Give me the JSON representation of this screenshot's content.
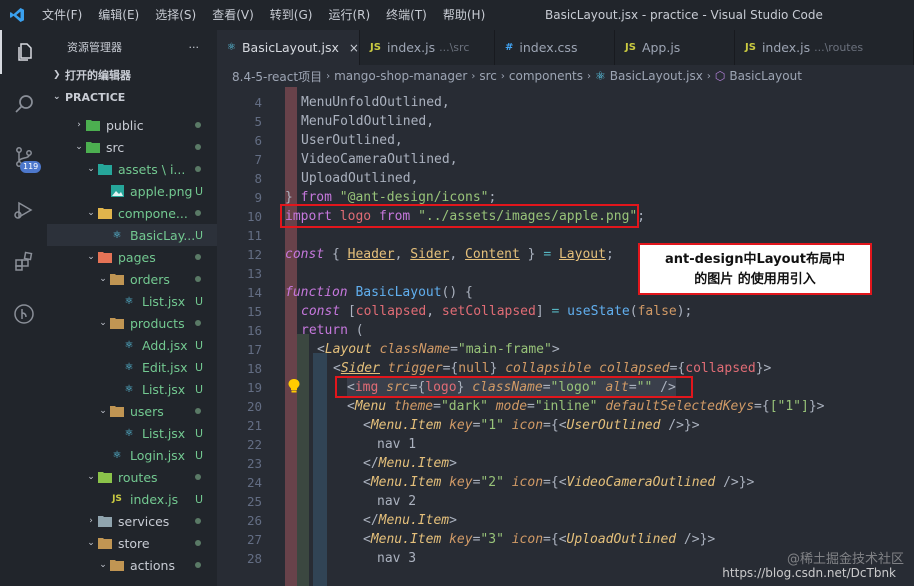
{
  "titlebar": {
    "menu": [
      "文件(F)",
      "编辑(E)",
      "选择(S)",
      "查看(V)",
      "转到(G)",
      "运行(R)",
      "终端(T)",
      "帮助(H)"
    ],
    "window_title": "BasicLayout.jsx - practice - Visual Studio Code"
  },
  "activity": {
    "scm_badge": "119"
  },
  "sidebar": {
    "title": "资源管理器",
    "more": "···",
    "open_editors": "打开的编辑器",
    "project": "PRACTICE",
    "items": [
      {
        "name": "public",
        "status": "dot"
      },
      {
        "name": "src",
        "status": "dot"
      },
      {
        "name": "assets \\ i...",
        "status": "dot"
      },
      {
        "name": "apple.png",
        "status": "U"
      },
      {
        "name": "compone...",
        "status": "dot"
      },
      {
        "name": "BasicLay...",
        "status": "U"
      },
      {
        "name": "pages",
        "status": "dot"
      },
      {
        "name": "orders",
        "status": "dot"
      },
      {
        "name": "List.jsx",
        "status": "U"
      },
      {
        "name": "products",
        "status": "dot"
      },
      {
        "name": "Add.jsx",
        "status": "U"
      },
      {
        "name": "Edit.jsx",
        "status": "U"
      },
      {
        "name": "List.jsx",
        "status": "U"
      },
      {
        "name": "users",
        "status": "dot"
      },
      {
        "name": "List.jsx",
        "status": "U"
      },
      {
        "name": "Login.jsx",
        "status": "U"
      },
      {
        "name": "routes",
        "status": "dot"
      },
      {
        "name": "index.js",
        "status": "U"
      },
      {
        "name": "services",
        "status": "dot"
      },
      {
        "name": "store",
        "status": "dot"
      },
      {
        "name": "actions",
        "status": "dot"
      }
    ]
  },
  "tabs": [
    {
      "label": "BasicLayout.jsx",
      "desc": "",
      "icon": "⚛",
      "close": "×"
    },
    {
      "label": "index.js",
      "desc": "...\\src",
      "icon": "JS",
      "close": ""
    },
    {
      "label": "index.css",
      "desc": "",
      "icon": "#",
      "close": ""
    },
    {
      "label": "App.js",
      "desc": "",
      "icon": "JS",
      "close": ""
    },
    {
      "label": "index.js",
      "desc": "...\\routes",
      "icon": "JS",
      "close": ""
    }
  ],
  "breadcrumb": [
    "8.4-5-react项目",
    "mango-shop-manager",
    "src",
    "components",
    "BasicLayout.jsx",
    "BasicLayout"
  ],
  "code": {
    "line_numbers": [
      "4",
      "5",
      "6",
      "7",
      "8",
      "9",
      "10",
      "11",
      "12",
      "13",
      "14",
      "15",
      "16",
      "17",
      "18",
      "19",
      "20",
      "21",
      "22",
      "23",
      "24",
      "25",
      "26",
      "27",
      "28"
    ],
    "l4": "MenuUnfoldOutlined,",
    "l5": "MenuFoldOutlined,",
    "l6": "UserOutlined,",
    "l7": "VideoCameraOutlined,",
    "l8": "UploadOutlined,",
    "l9_from": "from",
    "l9_str": "\"@ant-design/icons\"",
    "l10_import": "import",
    "l10_name": "logo",
    "l10_from": "from",
    "l10_str": "\"../assets/images/apple.png\"",
    "l12_const": "const",
    "l12_header": "Header",
    "l12_sider": "Sider",
    "l12_content": "Content",
    "l12_layout": "Layout",
    "l14_function": "function",
    "l14_name": "BasicLayout",
    "l15_const": "const",
    "l15_a": "collapsed",
    "l15_b": "setCollapsed",
    "l15_fn": "useState",
    "l15_val": "false",
    "l16_return": "return",
    "l17_tag": "Layout",
    "l17_attr": "className",
    "l17_val": "\"main-frame\"",
    "l18_tag": "Sider",
    "l18_attr1": "trigger",
    "l18_val1": "null",
    "l18_attr2": "collapsible",
    "l18_attr3": "collapsed",
    "l18_val3": "collapsed",
    "l19_tag": "img",
    "l19_attr1": "src",
    "l19_val1": "logo",
    "l19_attr2": "className",
    "l19_val2": "\"logo\"",
    "l19_attr3": "alt",
    "l19_val3": "\"\"",
    "l20_tag": "Menu",
    "l20_attr1": "theme",
    "l20_val1": "\"dark\"",
    "l20_attr2": "mode",
    "l20_val2": "\"inline\"",
    "l20_attr3": "defaultSelectedKeys",
    "l20_val3": "[\"1\"]",
    "item_tag": "Menu.Item",
    "key_attr": "key",
    "icon_attr": "icon",
    "k1": "\"1\"",
    "k2": "\"2\"",
    "k3": "\"3\"",
    "icon1": "UserOutlined",
    "icon2": "VideoCameraOutlined",
    "icon3": "UploadOutlined",
    "nav1": "nav 1",
    "nav2": "nav 2",
    "nav3": "nav 3"
  },
  "annotation": {
    "line1": "ant-design中Layout布局中",
    "line2": "的图片 的使用用引入"
  },
  "watermark": {
    "top": "@稀土掘金技术社区",
    "bottom": "https://blog.csdn.net/DcTbnk"
  },
  "colors": {
    "editor_bg": "#282c34",
    "sidebar_bg": "#21252b",
    "highlight_border": "#e2161c",
    "untracked": "#73c991"
  }
}
